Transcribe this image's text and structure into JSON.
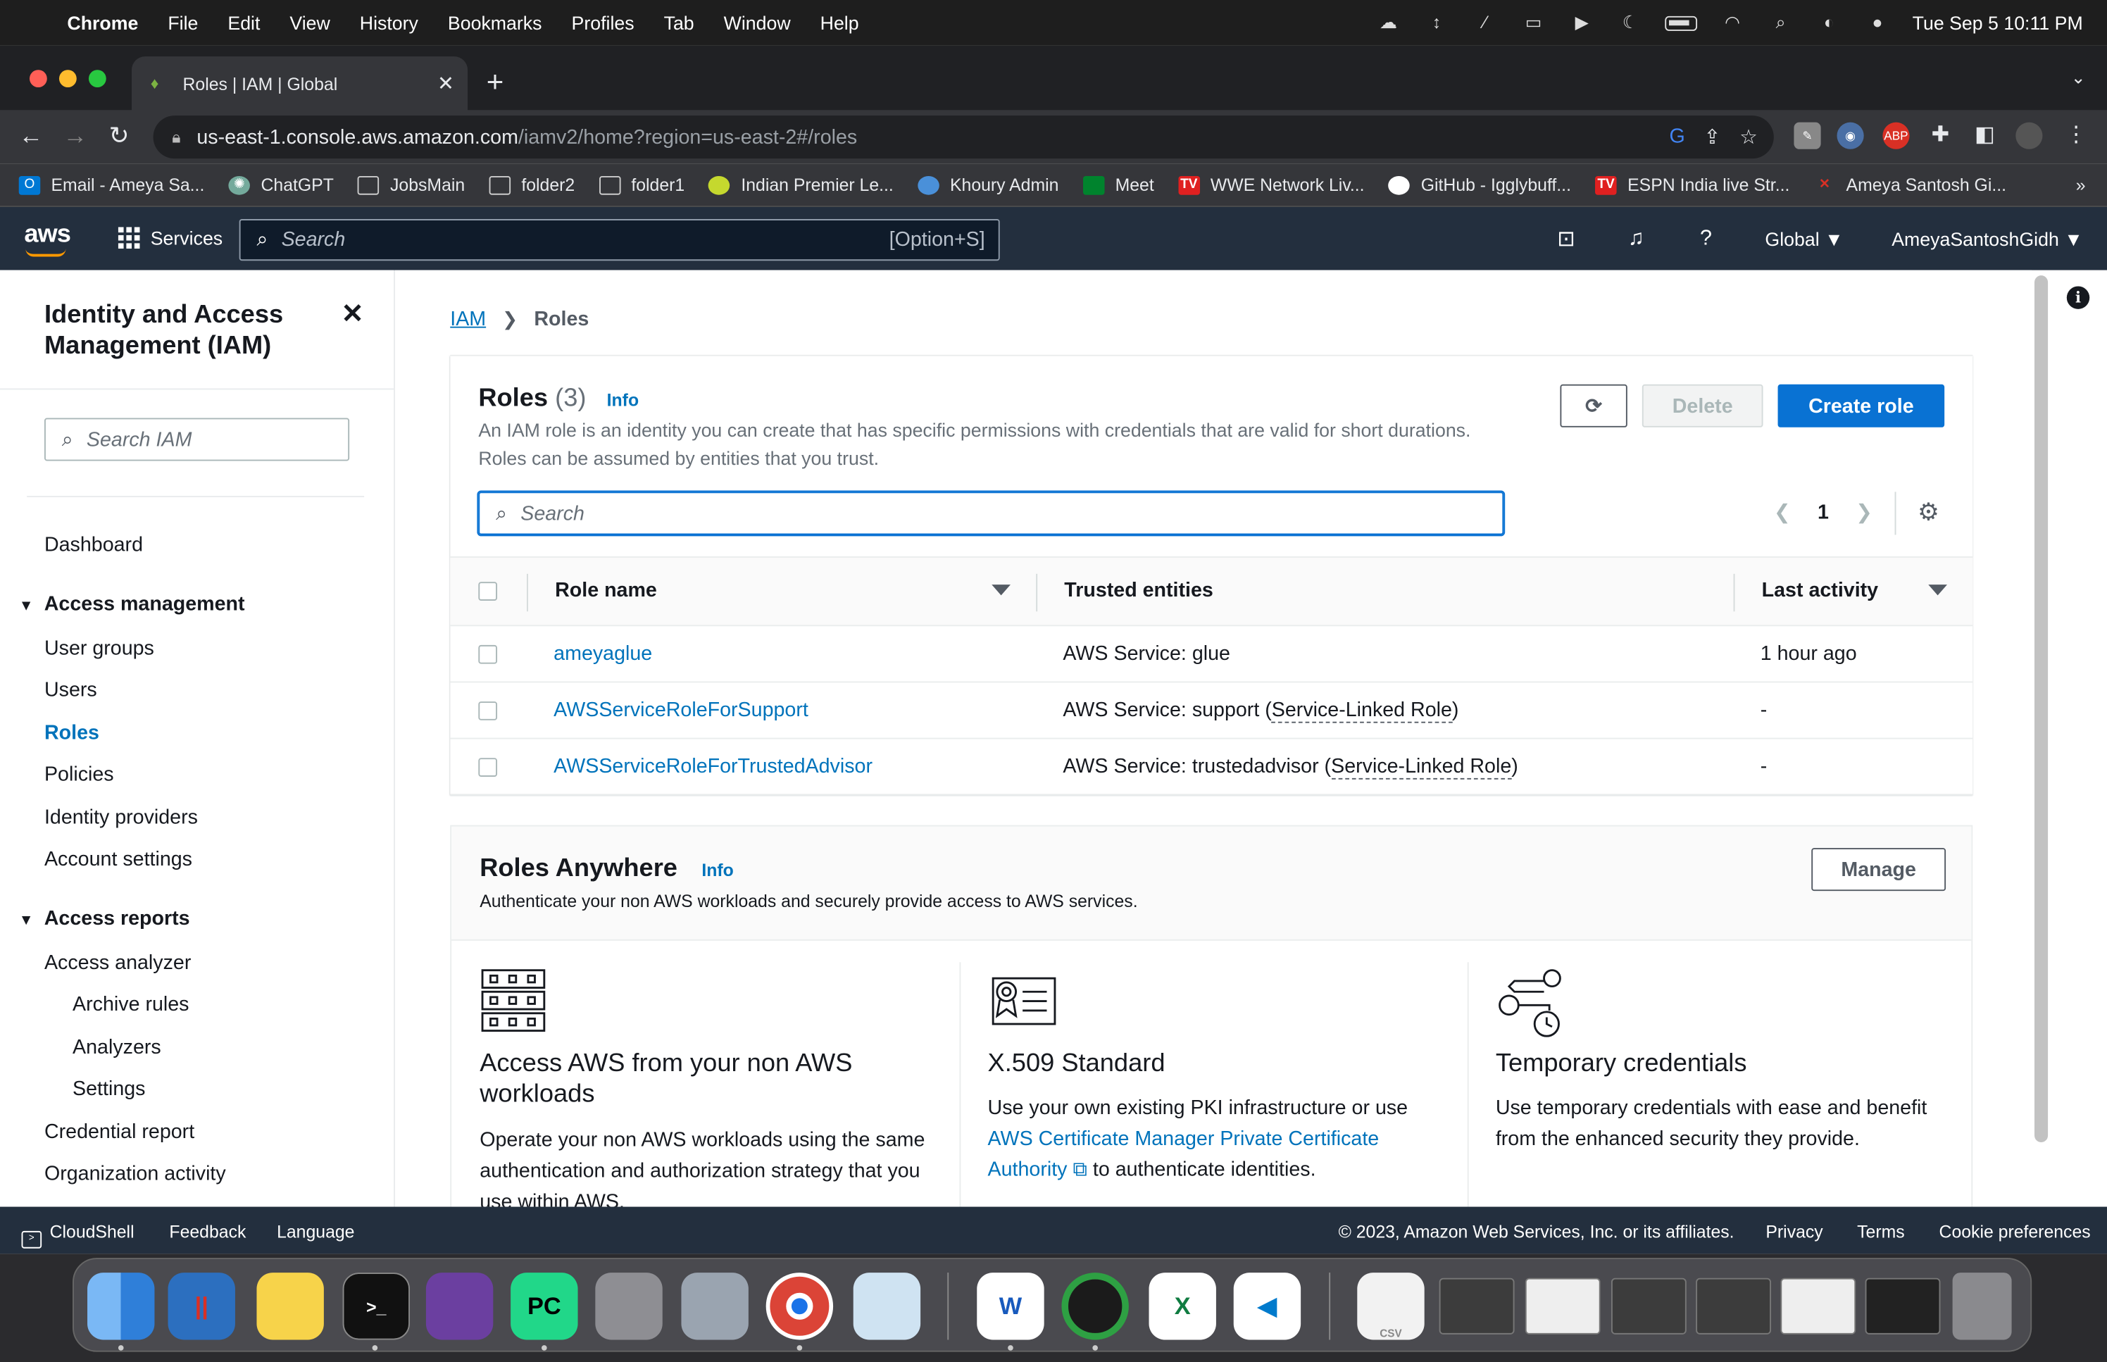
{
  "macos": {
    "menu": [
      "Chrome",
      "File",
      "Edit",
      "View",
      "History",
      "Bookmarks",
      "Profiles",
      "Tab",
      "Window",
      "Help"
    ],
    "datetime": "Tue Sep 5  10:11 PM"
  },
  "browser": {
    "tab_title": "Roles | IAM | Global",
    "url_host": "us-east-1.console.aws.amazon.com",
    "url_path": "/iamv2/home?region=us-east-2#/roles",
    "bookmarks": [
      {
        "label": "Email - Ameya Sa...",
        "icon": "outlook-icon",
        "color": "#0078d4"
      },
      {
        "label": "ChatGPT",
        "icon": "chatgpt-icon",
        "color": "#74aa9c"
      },
      {
        "label": "JobsMain",
        "icon": "folder-icon",
        "color": ""
      },
      {
        "label": "folder2",
        "icon": "folder-icon",
        "color": ""
      },
      {
        "label": "folder1",
        "icon": "folder-icon",
        "color": ""
      },
      {
        "label": "Indian Premier Le...",
        "icon": "ball-icon",
        "color": "#c5d82e"
      },
      {
        "label": "Khoury Admin",
        "icon": "khoury-icon",
        "color": "#4a90d9"
      },
      {
        "label": "Meet",
        "icon": "meet-icon",
        "color": "#00832d"
      },
      {
        "label": "WWE Network Liv...",
        "icon": "tv-icon",
        "color": "#e02020"
      },
      {
        "label": "GitHub - Igglybuff...",
        "icon": "github-icon",
        "color": "#ffffff"
      },
      {
        "label": "ESPN India live Str...",
        "icon": "tv-icon",
        "color": "#e02020"
      },
      {
        "label": "Ameya Santosh Gi...",
        "icon": "x-icon",
        "color": "#d93025"
      }
    ],
    "more": "»"
  },
  "aws_nav": {
    "logo": "aws",
    "services": "Services",
    "search_placeholder": "Search",
    "search_shortcut": "[Option+S]",
    "region": "Global",
    "account": "AmeyaSantoshGidh"
  },
  "sidebar": {
    "title": "Identity and Access Management (IAM)",
    "search_placeholder": "Search IAM",
    "dashboard": "Dashboard",
    "section_access_management": "Access management",
    "access_items": [
      "User groups",
      "Users",
      "Roles",
      "Policies",
      "Identity providers",
      "Account settings"
    ],
    "section_access_reports": "Access reports",
    "access_analyzer": "Access analyzer",
    "analyzer_items": [
      "Archive rules",
      "Analyzers",
      "Settings"
    ],
    "report_items": [
      "Credential report",
      "Organization activity"
    ]
  },
  "breadcrumb": {
    "root": "IAM",
    "current": "Roles"
  },
  "roles_panel": {
    "title": "Roles",
    "count": "(3)",
    "info": "Info",
    "description": "An IAM role is an identity you can create that has specific permissions with credentials that are valid for short durations. Roles can be assumed by entities that you trust.",
    "delete_label": "Delete",
    "create_label": "Create role",
    "search_placeholder": "Search",
    "page": "1",
    "columns": [
      "Role name",
      "Trusted entities",
      "Last activity"
    ],
    "rows": [
      {
        "name": "ameyaglue",
        "entity": "AWS Service: glue",
        "entity_suffix": "",
        "last": "1 hour ago"
      },
      {
        "name": "AWSServiceRoleForSupport",
        "entity": "AWS Service: support (",
        "entity_suffix": "Service-Linked Role",
        "last": "-"
      },
      {
        "name": "AWSServiceRoleForTrustedAdvisor",
        "entity": "AWS Service: trustedadvisor (",
        "entity_suffix": "Service-Linked Role",
        "last": "-"
      }
    ]
  },
  "roles_anywhere": {
    "title": "Roles Anywhere",
    "info": "Info",
    "description": "Authenticate your non AWS workloads and securely provide access to AWS services.",
    "manage_label": "Manage",
    "cards": [
      {
        "title": "Access AWS from your non AWS workloads",
        "body": "Operate your non AWS workloads using the same authentication and authorization strategy that you use within AWS."
      },
      {
        "title": "X.509 Standard",
        "body_pre": "Use your own existing PKI infrastructure or use ",
        "link": "AWS Certificate Manager Private Certificate Authority",
        "body_post": " to authenticate identities."
      },
      {
        "title": "Temporary credentials",
        "body": "Use temporary credentials with ease and benefit from the enhanced security they provide."
      }
    ]
  },
  "footer": {
    "cloudshell": "CloudShell",
    "feedback": "Feedback",
    "language": "Language",
    "copyright": "© 2023, Amazon Web Services, Inc. or its affiliates.",
    "privacy": "Privacy",
    "terms": "Terms",
    "cookies": "Cookie preferences"
  },
  "colors": {
    "aws_nav": "#232f3e",
    "link": "#0073bb",
    "primary_button": "#0972d3",
    "aws_orange": "#ff9900"
  }
}
